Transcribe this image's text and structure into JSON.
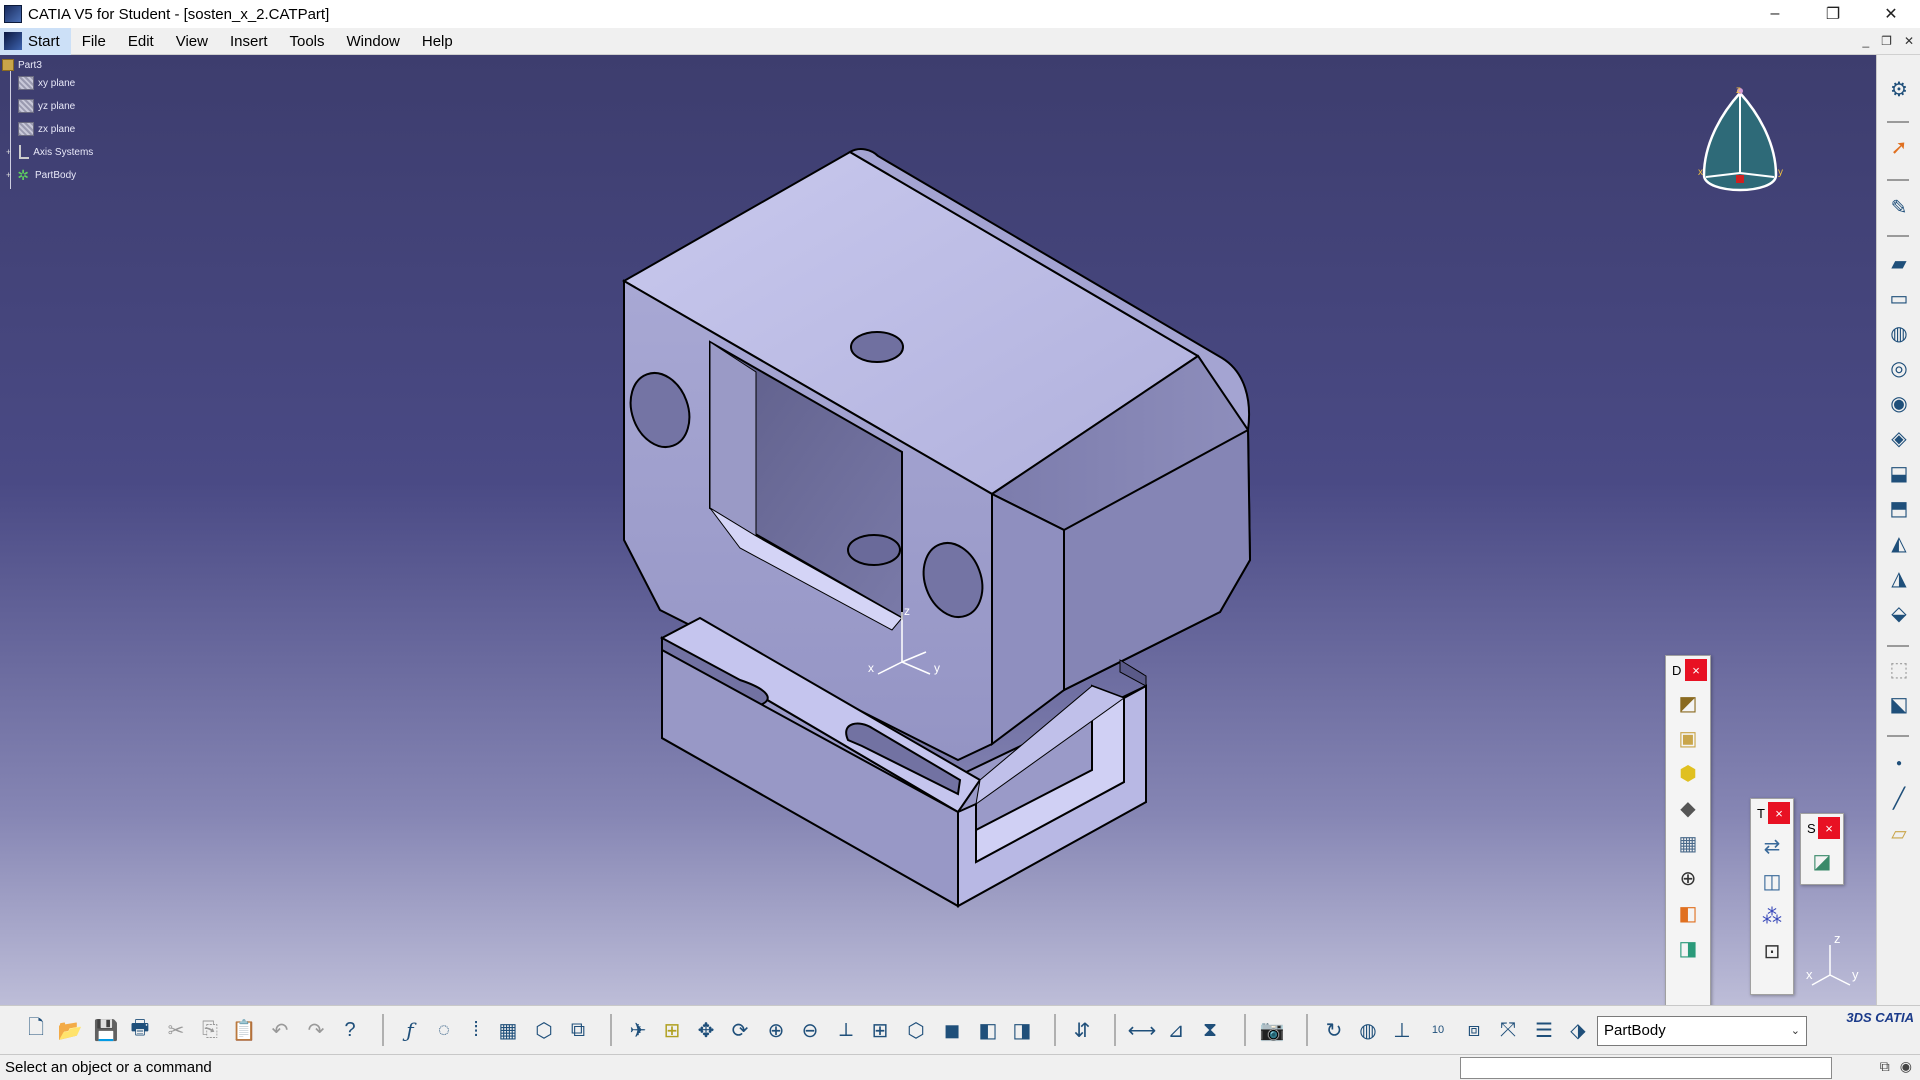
{
  "window": {
    "title": "CATIA V5 for Student - [sosten_x_2.CATPart]",
    "controls": [
      "–",
      "❐",
      "✕"
    ]
  },
  "menu": {
    "start": "Start",
    "items": [
      "File",
      "Edit",
      "View",
      "Insert",
      "Tools",
      "Window",
      "Help"
    ],
    "doc_controls": [
      "_",
      "❐",
      "✕"
    ]
  },
  "tree": {
    "root": "Part3",
    "items": [
      {
        "label": "xy plane",
        "icon": "plane-icon"
      },
      {
        "label": "yz plane",
        "icon": "plane-icon"
      },
      {
        "label": "zx plane",
        "icon": "plane-icon"
      },
      {
        "label": "Axis Systems",
        "icon": "axis-system-icon"
      },
      {
        "label": "PartBody",
        "icon": "partbody-gear-icon"
      }
    ]
  },
  "compass": {
    "labels": [
      "z",
      "x",
      "y"
    ]
  },
  "model_axis": {
    "labels": [
      "z",
      "x",
      "y"
    ]
  },
  "corner_axis": {
    "labels": [
      "z",
      "x",
      "y"
    ]
  },
  "floating_toolbars": [
    {
      "title": "D",
      "close": "×",
      "icons": [
        "cube-plane-icon",
        "box-icon",
        "yellow-cube-icon",
        "prism-icon",
        "grid-cube-icon",
        "crosshair-icon",
        "orange-box-icon",
        "green-box-icon"
      ]
    },
    {
      "title": "T",
      "close": "×",
      "icons": [
        "transform-icon",
        "mirror-icon",
        "pattern-icon",
        "scale-icon"
      ]
    },
    {
      "title": "S",
      "close": "×",
      "icons": [
        "surface-body-icon"
      ]
    }
  ],
  "body_selector": {
    "value": "PartBody"
  },
  "status": {
    "text": "Select an object or a command"
  },
  "colors": {
    "part_face": "#b3b3dd",
    "part_dark": "#6c6c9c",
    "bg_top": "#3d3d6e",
    "bg_bottom": "#bdbdd8",
    "close_red": "#e81123"
  }
}
